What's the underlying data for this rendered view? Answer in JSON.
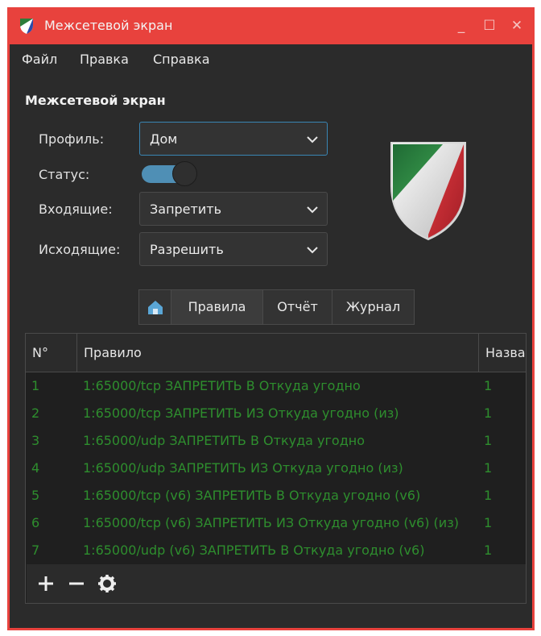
{
  "window": {
    "title": "Межсетевой экран",
    "accent": "#e8423d"
  },
  "menu": [
    {
      "label": "Файл"
    },
    {
      "label": "Правка"
    },
    {
      "label": "Справка"
    }
  ],
  "section_title": "Межсетевой экран",
  "form": {
    "profile_label": "Профиль:",
    "profile_value": "Дом",
    "status_label": "Статус:",
    "status_on": true,
    "incoming_label": "Входящие:",
    "incoming_value": "Запретить",
    "outgoing_label": "Исходящие:",
    "outgoing_value": "Разрешить"
  },
  "tabs": {
    "home_icon": "home-icon",
    "items": [
      {
        "label": "Правила"
      },
      {
        "label": "Отчёт"
      },
      {
        "label": "Журнал"
      }
    ],
    "active": "Правила"
  },
  "table": {
    "columns": [
      "N°",
      "Правило",
      "Назва"
    ],
    "rows": [
      {
        "num": "1",
        "rule": "1:65000/tcp ЗАПРЕТИТЬ В Откуда угодно",
        "name": "1"
      },
      {
        "num": "2",
        "rule": "1:65000/tcp ЗАПРЕТИТЬ ИЗ Откуда угодно (из)",
        "name": "1"
      },
      {
        "num": "3",
        "rule": "1:65000/udp ЗАПРЕТИТЬ В Откуда угодно",
        "name": "1"
      },
      {
        "num": "4",
        "rule": "1:65000/udp ЗАПРЕТИТЬ ИЗ Откуда угодно (из)",
        "name": "1"
      },
      {
        "num": "5",
        "rule": "1:65000/tcp (v6) ЗАПРЕТИТЬ В Откуда угодно (v6)",
        "name": "1"
      },
      {
        "num": "6",
        "rule": "1:65000/tcp (v6) ЗАПРЕТИТЬ ИЗ Откуда угодно (v6) (из)",
        "name": "1"
      },
      {
        "num": "7",
        "rule": "1:65000/udp (v6) ЗАПРЕТИТЬ В Откуда угодно (v6)",
        "name": "1"
      }
    ],
    "row_text_color": "#2e8e2e"
  },
  "toolbar": {
    "add_icon": "plus-icon",
    "remove_icon": "minus-icon",
    "settings_icon": "gear-icon"
  }
}
